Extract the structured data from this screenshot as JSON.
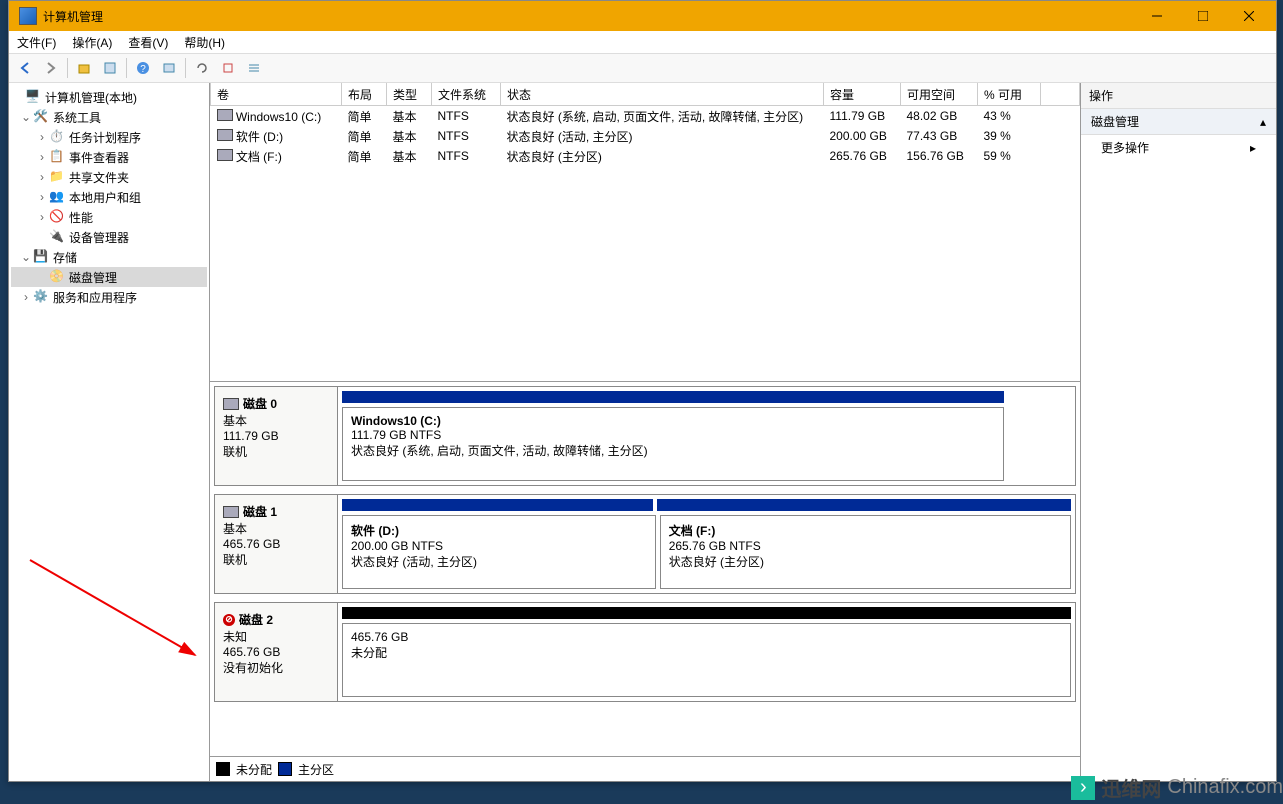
{
  "window": {
    "title": "计算机管理"
  },
  "menus": {
    "file": "文件(F)",
    "action": "操作(A)",
    "view": "查看(V)",
    "help": "帮助(H)"
  },
  "tree": {
    "root": "计算机管理(本地)",
    "system_tools": "系统工具",
    "task_scheduler": "任务计划程序",
    "event_viewer": "事件查看器",
    "shared_folders": "共享文件夹",
    "local_users": "本地用户和组",
    "performance": "性能",
    "device_manager": "设备管理器",
    "storage": "存储",
    "disk_management": "磁盘管理",
    "services_apps": "服务和应用程序"
  },
  "columns": {
    "volume": "卷",
    "layout": "布局",
    "type": "类型",
    "filesystem": "文件系统",
    "status": "状态",
    "capacity": "容量",
    "free": "可用空间",
    "pct": "% 可用"
  },
  "volumes": [
    {
      "name": "Windows10 (C:)",
      "layout": "简单",
      "type": "基本",
      "fs": "NTFS",
      "status": "状态良好 (系统, 启动, 页面文件, 活动, 故障转储, 主分区)",
      "capacity": "111.79 GB",
      "free": "48.02 GB",
      "pct": "43 %"
    },
    {
      "name": "软件 (D:)",
      "layout": "简单",
      "type": "基本",
      "fs": "NTFS",
      "status": "状态良好 (活动, 主分区)",
      "capacity": "200.00 GB",
      "free": "77.43 GB",
      "pct": "39 %"
    },
    {
      "name": "文档 (F:)",
      "layout": "简单",
      "type": "基本",
      "fs": "NTFS",
      "status": "状态良好 (主分区)",
      "capacity": "265.76 GB",
      "free": "156.76 GB",
      "pct": "59 %"
    }
  ],
  "disks": [
    {
      "title": "磁盘 0",
      "type": "基本",
      "capacity": "111.79 GB",
      "status": "联机",
      "partitions": [
        {
          "name": "Windows10  (C:)",
          "size": "111.79 GB NTFS",
          "status": "状态良好 (系统, 启动, 页面文件, 活动, 故障转储, 主分区)",
          "weight": 1,
          "header": "primary"
        }
      ]
    },
    {
      "title": "磁盘 1",
      "type": "基本",
      "capacity": "465.76 GB",
      "status": "联机",
      "partitions": [
        {
          "name": "软件  (D:)",
          "size": "200.00 GB NTFS",
          "status": "状态良好 (活动, 主分区)",
          "weight": 200,
          "header": "primary"
        },
        {
          "name": "文档  (F:)",
          "size": "265.76 GB NTFS",
          "status": "状态良好 (主分区)",
          "weight": 266,
          "header": "primary"
        }
      ]
    },
    {
      "title": "磁盘 2",
      "type": "未知",
      "capacity": "465.76 GB",
      "status": "没有初始化",
      "error": true,
      "partitions": [
        {
          "name": "",
          "size": "465.76 GB",
          "status": "未分配",
          "weight": 1,
          "header": "unalloc"
        }
      ]
    }
  ],
  "legend": {
    "unallocated": "未分配",
    "primary": "主分区"
  },
  "actions": {
    "header": "操作",
    "category": "磁盘管理",
    "more": "更多操作"
  },
  "watermark": {
    "brand": "迅维网",
    "domain": "Chinafix.com"
  }
}
